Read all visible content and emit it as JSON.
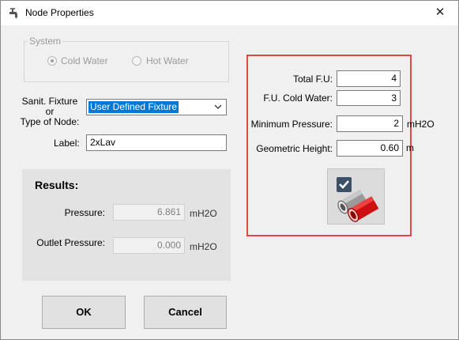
{
  "window": {
    "title": "Node Properties",
    "close_glyph": "✕"
  },
  "system": {
    "legend": "System",
    "options": [
      {
        "label": "Cold Water",
        "checked": true
      },
      {
        "label": "Hot Water",
        "checked": false
      }
    ]
  },
  "fixture": {
    "label": "Sanit. Fixture or Type of Node:",
    "label_line1": "Sanit. Fixture or",
    "label_line2": "Type of Node:",
    "selected": "User Defined Fixture"
  },
  "label_field": {
    "label": "Label:",
    "value": "2xLav"
  },
  "results": {
    "title": "Results:",
    "pressure_label": "Pressure:",
    "pressure_value": "6.861",
    "pressure_unit": "mH2O",
    "outlet_label": "Outlet Pressure:",
    "outlet_value": "0.000",
    "outlet_unit": "mH2O"
  },
  "properties": {
    "total_fu_label": "Total F.U:",
    "total_fu_value": "4",
    "fu_cold_label": "F.U. Cold Water:",
    "fu_cold_value": "3",
    "min_pressure_label": "Minimum Pressure:",
    "min_pressure_value": "2",
    "min_pressure_unit": "mH2O",
    "geo_height_label": "Geometric Height:",
    "geo_height_value": "0.60",
    "geo_height_unit": "m"
  },
  "buttons": {
    "ok": "OK",
    "cancel": "Cancel"
  },
  "colors": {
    "highlight": "#e04848",
    "selection": "#0078d7",
    "pipe_red": "#e02020"
  }
}
